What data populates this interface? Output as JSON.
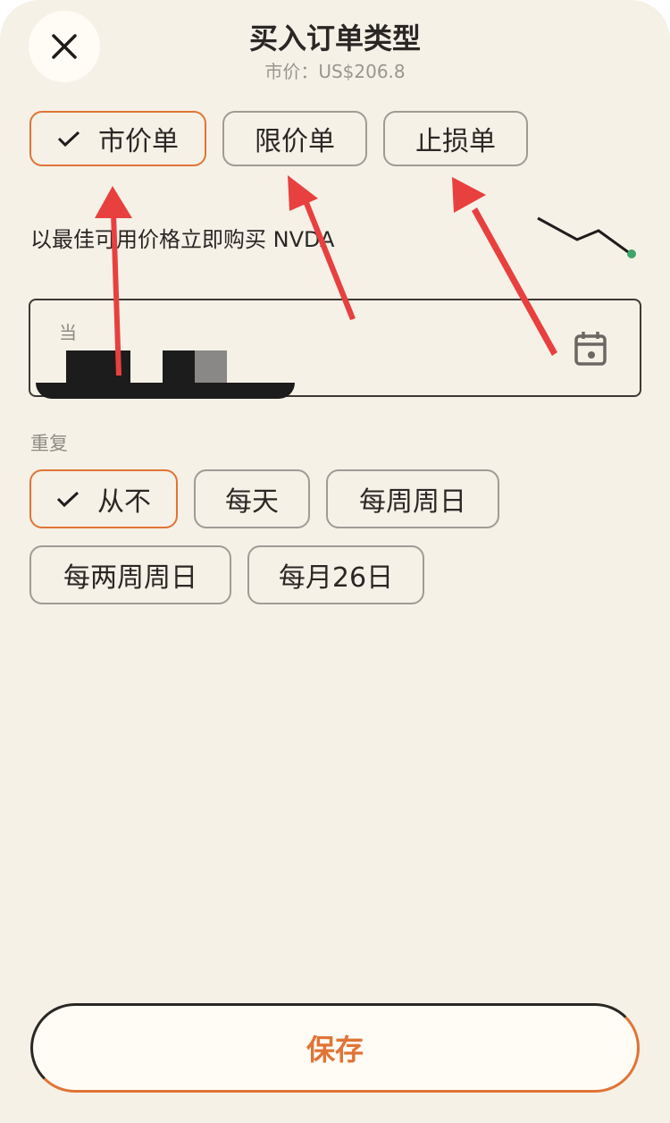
{
  "header": {
    "title": "买入订单类型",
    "subtitle": "市价：US$206.8"
  },
  "order_types": [
    {
      "label": "市价单",
      "selected": true
    },
    {
      "label": "限价单",
      "selected": false
    },
    {
      "label": "止损单",
      "selected": false
    }
  ],
  "description": "以最佳可用价格立即购买 NVDA",
  "date_field": {
    "label": "当"
  },
  "repeat": {
    "label": "重复",
    "options": [
      {
        "label": "从不",
        "selected": true
      },
      {
        "label": "每天",
        "selected": false
      },
      {
        "label": "每周周日",
        "selected": false
      },
      {
        "label": "每两周周日",
        "selected": false
      },
      {
        "label": "每月26日",
        "selected": false
      }
    ]
  },
  "save_label": "保存",
  "colors": {
    "accent": "#e07436",
    "background": "#f5f1e7",
    "annotation_arrow": "#e8403f",
    "sparkline_dot": "#3fa56a"
  },
  "icons": [
    "close-icon",
    "check-icon",
    "calendar-icon"
  ]
}
